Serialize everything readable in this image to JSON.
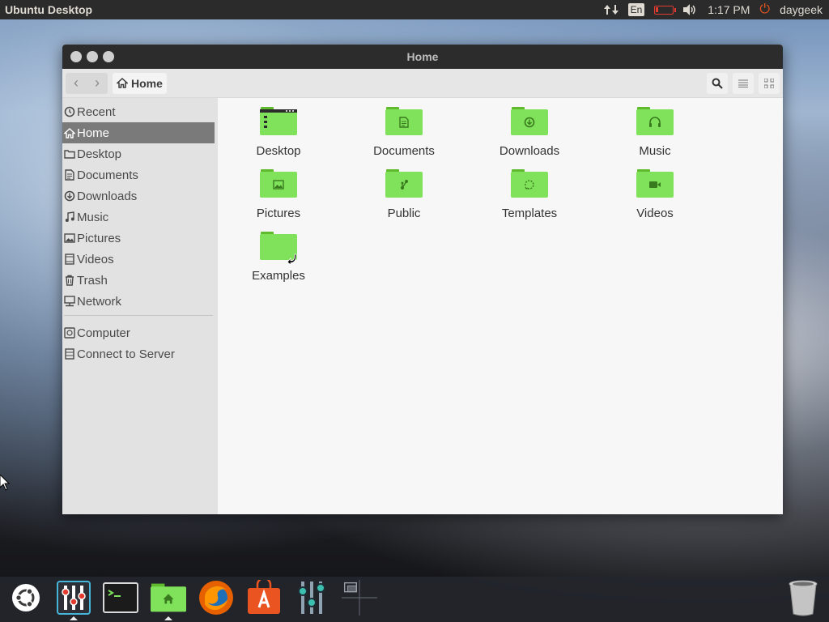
{
  "top_panel": {
    "app_title": "Ubuntu Desktop",
    "keyboard_layout": "En",
    "battery_level": 0.15,
    "clock": "1:17 PM",
    "user": "daygeek"
  },
  "window": {
    "title": "Home",
    "breadcrumb": "Home"
  },
  "sidebar": {
    "items": [
      {
        "label": "Recent",
        "icon": "clock-icon"
      },
      {
        "label": "Home",
        "icon": "home-icon",
        "active": true
      },
      {
        "label": "Desktop",
        "icon": "folder-icon"
      },
      {
        "label": "Documents",
        "icon": "document-icon"
      },
      {
        "label": "Downloads",
        "icon": "download-icon"
      },
      {
        "label": "Music",
        "icon": "music-icon"
      },
      {
        "label": "Pictures",
        "icon": "picture-icon"
      },
      {
        "label": "Videos",
        "icon": "video-icon"
      },
      {
        "label": "Trash",
        "icon": "trash-icon"
      },
      {
        "label": "Network",
        "icon": "network-icon"
      }
    ],
    "devices": [
      {
        "label": "Computer",
        "icon": "computer-icon"
      },
      {
        "label": "Connect to Server",
        "icon": "server-icon"
      }
    ]
  },
  "files": [
    {
      "label": "Desktop",
      "icon": "desktop-folder-icon"
    },
    {
      "label": "Documents",
      "icon": "documents-folder-icon"
    },
    {
      "label": "Downloads",
      "icon": "downloads-folder-icon"
    },
    {
      "label": "Music",
      "icon": "music-folder-icon"
    },
    {
      "label": "Pictures",
      "icon": "pictures-folder-icon"
    },
    {
      "label": "Public",
      "icon": "public-folder-icon"
    },
    {
      "label": "Templates",
      "icon": "templates-folder-icon"
    },
    {
      "label": "Videos",
      "icon": "videos-folder-icon"
    },
    {
      "label": "Examples",
      "icon": "examples-folder-link-icon"
    }
  ],
  "dock": {
    "items": [
      {
        "name": "ubuntu-logo-icon"
      },
      {
        "name": "system-settings-icon",
        "running": true
      },
      {
        "name": "terminal-icon"
      },
      {
        "name": "files-icon",
        "running": true
      },
      {
        "name": "firefox-icon"
      },
      {
        "name": "software-center-icon"
      },
      {
        "name": "unity-tweak-icon"
      },
      {
        "name": "workspace-switcher-icon"
      },
      {
        "name": "trash-icon"
      }
    ]
  },
  "colors": {
    "folder_green": "#7fe25a",
    "folder_tab": "#5fba2e",
    "accent_power": "#e95420",
    "battery_red": "#e53a2e"
  }
}
